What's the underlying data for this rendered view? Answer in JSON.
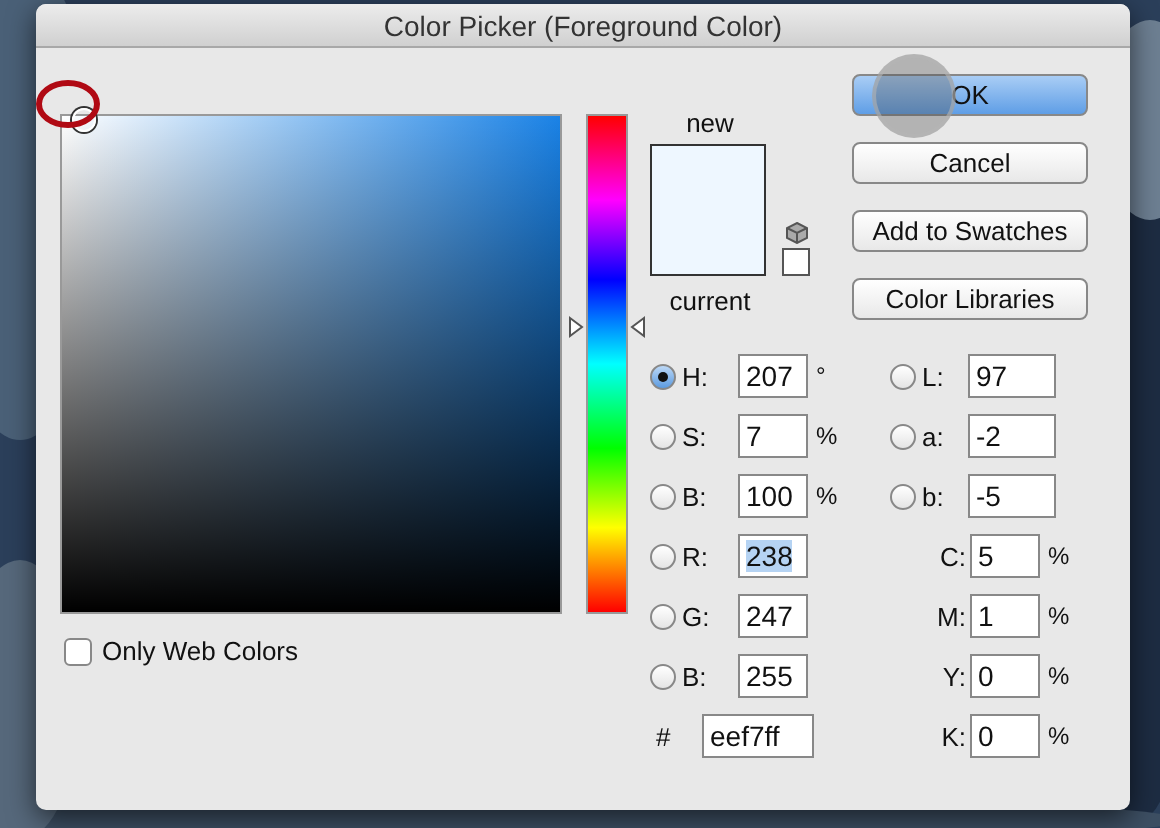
{
  "window": {
    "title": "Color Picker (Foreground Color)"
  },
  "color_field": {
    "marker_highlighted": true
  },
  "hue_slider": {
    "level": 0.575
  },
  "swatch": {
    "new_label": "new",
    "current_label": "current"
  },
  "only_web_colors": {
    "label": "Only Web Colors",
    "checked": false
  },
  "buttons": [
    {
      "label": "OK",
      "default": true,
      "pressed": true
    },
    {
      "label": "Cancel",
      "default": false,
      "pressed": false
    },
    {
      "label": "Add to Swatches",
      "default": false,
      "pressed": false
    },
    {
      "label": "Color Libraries",
      "default": false,
      "pressed": false
    }
  ],
  "channels": [
    {
      "label": "H:",
      "value": "207",
      "unit": "°",
      "selected": true,
      "text_selected": false
    },
    {
      "label": "S:",
      "value": "7",
      "unit": "%",
      "selected": false,
      "text_selected": false
    },
    {
      "label": "B:",
      "value": "100",
      "unit": "%",
      "selected": false,
      "text_selected": false
    },
    {
      "label": "R:",
      "value": "238",
      "selected": false,
      "text_selected": true
    },
    {
      "label": "G:",
      "value": "247",
      "selected": false,
      "text_selected": false
    },
    {
      "label": "B:",
      "value": "255",
      "selected": false,
      "text_selected": false
    }
  ],
  "lab": [
    {
      "label": "L:",
      "value": "97",
      "selected": false
    },
    {
      "label": "a:",
      "value": "-2",
      "selected": false
    },
    {
      "label": "b:",
      "value": "-5",
      "selected": false
    }
  ],
  "cmyk": [
    {
      "label": "C:",
      "value": "5",
      "unit": "%"
    },
    {
      "label": "M:",
      "value": "1",
      "unit": "%"
    },
    {
      "label": "Y:",
      "value": "0",
      "unit": "%"
    },
    {
      "label": "K:",
      "value": "0",
      "unit": "%"
    }
  ],
  "hex": {
    "label": "#",
    "value": "eef7ff"
  }
}
